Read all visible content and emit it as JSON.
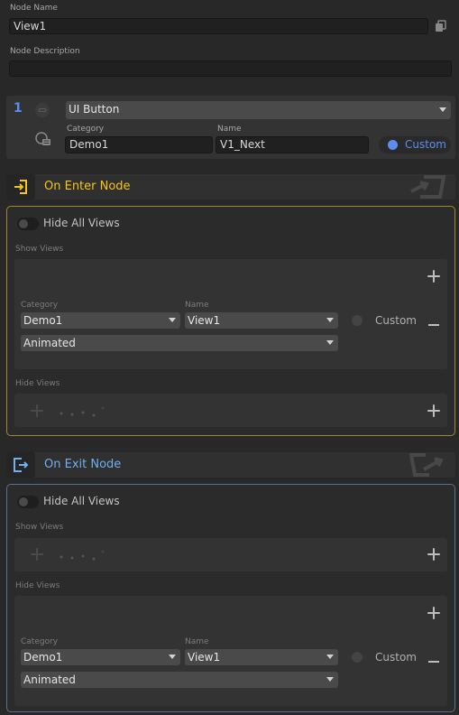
{
  "node": {
    "name_label": "Node Name",
    "name_value": "View1",
    "description_label": "Node Description",
    "description_value": ""
  },
  "trigger": {
    "index": "1",
    "type": "UI Button",
    "category_label": "Category",
    "category_value": "Demo1",
    "name_label": "Name",
    "name_value": "V1_Next",
    "custom_label": "Custom"
  },
  "enter": {
    "title": "On Enter Node",
    "hide_all_label": "Hide All Views",
    "show_views_label": "Show Views",
    "show_item": {
      "category_label": "Category",
      "category_value": "Demo1",
      "name_label": "Name",
      "name_value": "View1",
      "custom_label": "Custom",
      "animation": "Animated"
    },
    "hide_views_label": "Hide Views"
  },
  "exit": {
    "title": "On Exit Node",
    "hide_all_label": "Hide All Views",
    "show_views_label": "Show Views",
    "hide_views_label": "Hide Views",
    "hide_item": {
      "category_label": "Category",
      "category_value": "Demo1",
      "name_label": "Name",
      "name_value": "View1",
      "custom_label": "Custom",
      "animation": "Animated"
    }
  },
  "colors": {
    "enter_accent": "#f5c518",
    "exit_accent": "#6fb0f0",
    "custom_active": "#5b8ef0"
  },
  "icons": {
    "copy": "copy-icon",
    "enter": "enter-node-icon",
    "exit": "exit-node-icon",
    "link": "link-icon",
    "database": "database-icon"
  }
}
